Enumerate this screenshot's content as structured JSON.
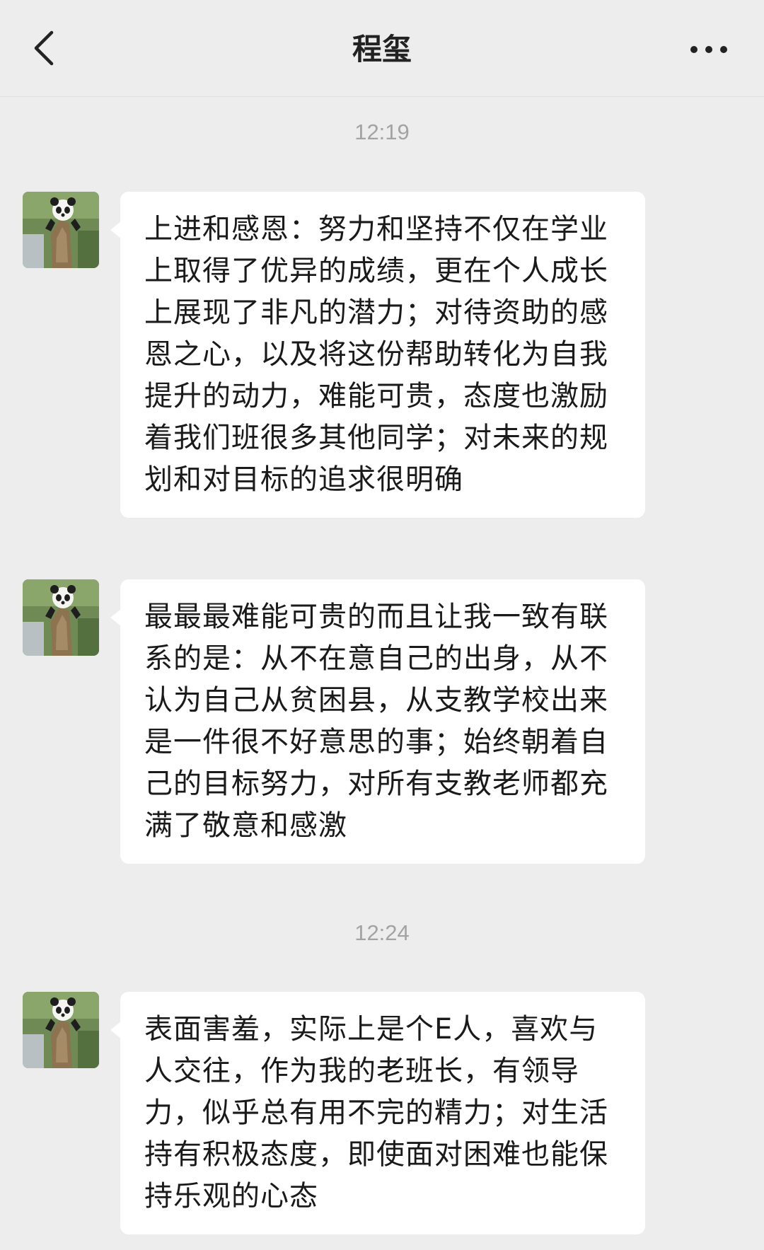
{
  "header": {
    "title": "程玺",
    "back_icon": "chevron-left-icon",
    "more_icon": "more-dots-icon"
  },
  "messages": [
    {
      "time": "12:19",
      "text": "上进和感恩：努力和坚持不仅在学业上取得了优异的成绩，更在个人成长上展现了非凡的潜力；对待资助的感恩之心，以及将这份帮助转化为自我提升的动力，难能可贵，态度也激励着我们班很多其他同学；对未来的规划和对目标的追求很明确"
    },
    {
      "text": "最最最难能可贵的而且让我一致有联系的是：从不在意自己的出身，从不认为自己从贫困县，从支教学校出来是一件很不好意思的事；始终朝着自己的目标努力，对所有支教老师都充满了敬意和感激"
    },
    {
      "time": "12:24",
      "text": "表面害羞，实际上是个E人，喜欢与人交往，作为我的老班长，有领导力，似乎总有用不完的精力；对生活持有积极态度，即使面对困难也能保持乐观的心态"
    }
  ],
  "avatar_icon": "panda-avatar-icon",
  "colors": {
    "background": "#ededed",
    "bubble": "#ffffff",
    "timestamp": "#a3a3a3",
    "text": "#1a1a1a"
  }
}
